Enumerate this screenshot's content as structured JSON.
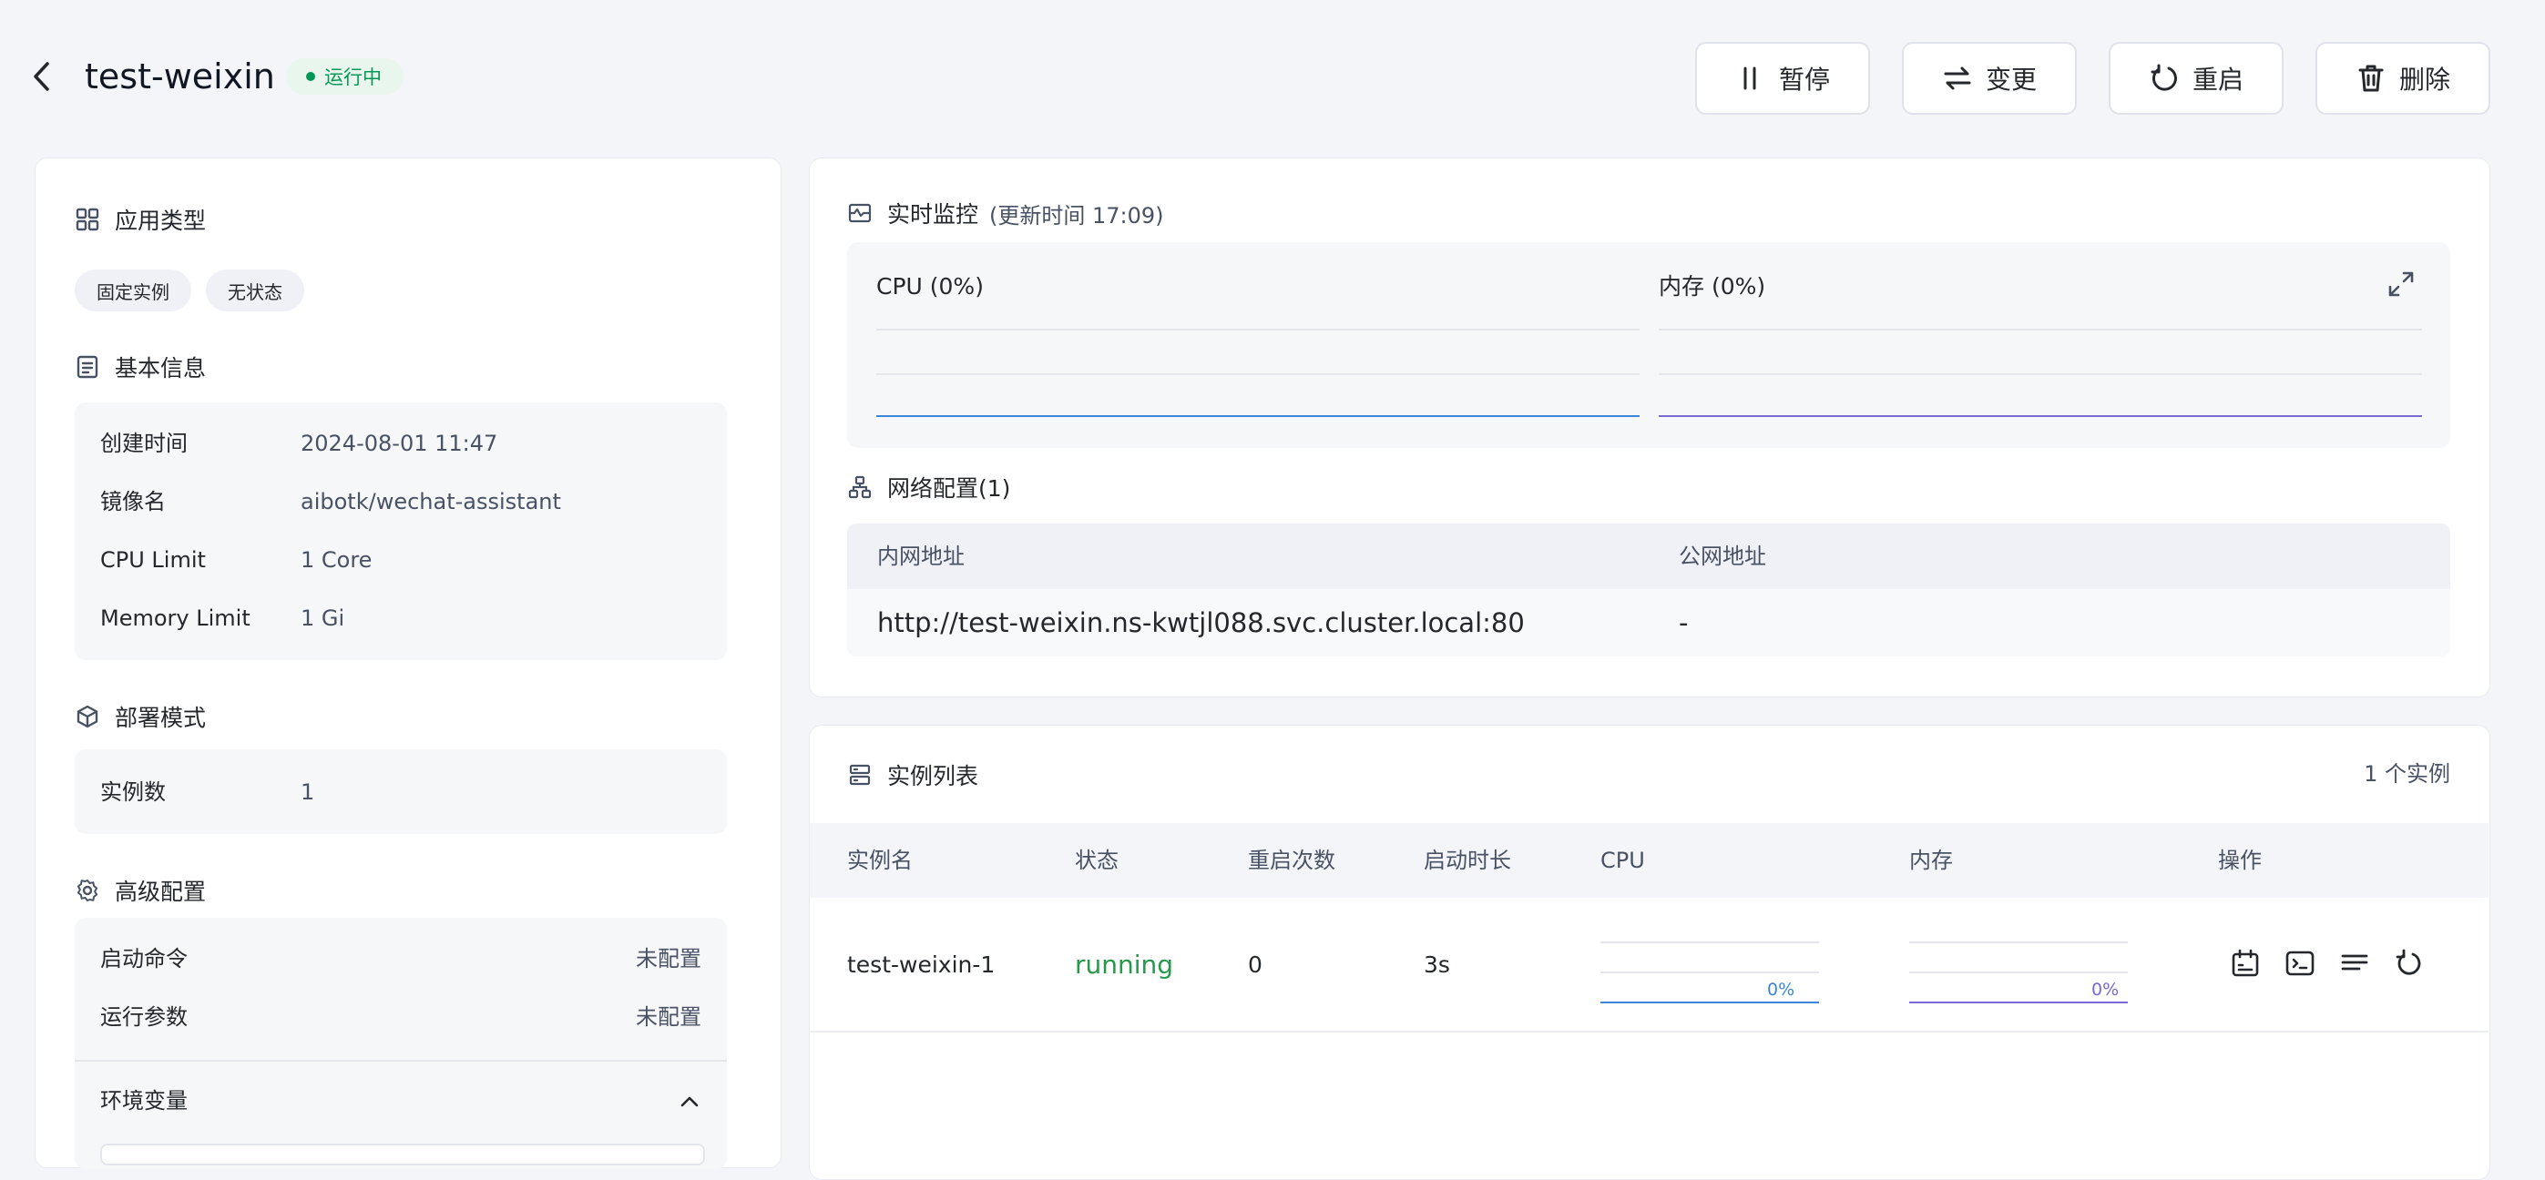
{
  "header": {
    "title": "test-weixin",
    "status": "运行中",
    "buttons": {
      "pause": "暂停",
      "change": "变更",
      "restart": "重启",
      "delete": "删除"
    }
  },
  "left": {
    "app_type": {
      "title": "应用类型",
      "tags": [
        "固定实例",
        "无状态"
      ]
    },
    "basic_info": {
      "title": "基本信息",
      "rows": [
        {
          "key": "创建时间",
          "value": "2024-08-01 11:47"
        },
        {
          "key": "镜像名",
          "value": "aibotk/wechat-assistant"
        },
        {
          "key": "CPU Limit",
          "value": "1 Core"
        },
        {
          "key": "Memory Limit",
          "value": "1 Gi"
        }
      ]
    },
    "deploy_mode": {
      "title": "部署模式",
      "key": "实例数",
      "value": "1"
    },
    "advanced": {
      "title": "高级配置",
      "rows": [
        {
          "key": "启动命令",
          "value": "未配置"
        },
        {
          "key": "运行参数",
          "value": "未配置"
        }
      ],
      "env_label": "环境变量"
    }
  },
  "monitor": {
    "title": "实时监控",
    "update": "(更新时间  17:09)",
    "cpu_label": "CPU  (0%)",
    "mem_label": "内存  (0%)",
    "cpu_color": "#3a86d9",
    "mem_color": "#7a68d6"
  },
  "network": {
    "title": "网络配置(1)",
    "col_internal": "内网地址",
    "col_public": "公网地址",
    "internal": "http://test-weixin.ns-kwtjl088.svc.cluster.local:80",
    "public": "-"
  },
  "instances": {
    "title": "实例列表",
    "count": "1 个实例",
    "columns": [
      "实例名",
      "状态",
      "重启次数",
      "启动时长",
      "CPU",
      "内存",
      "操作"
    ],
    "rows": [
      {
        "name": "test-weixin-1",
        "status": "running",
        "restarts": "0",
        "uptime": "3s",
        "cpu": "0%",
        "mem": "0%"
      }
    ],
    "status_color": "#26994d"
  }
}
